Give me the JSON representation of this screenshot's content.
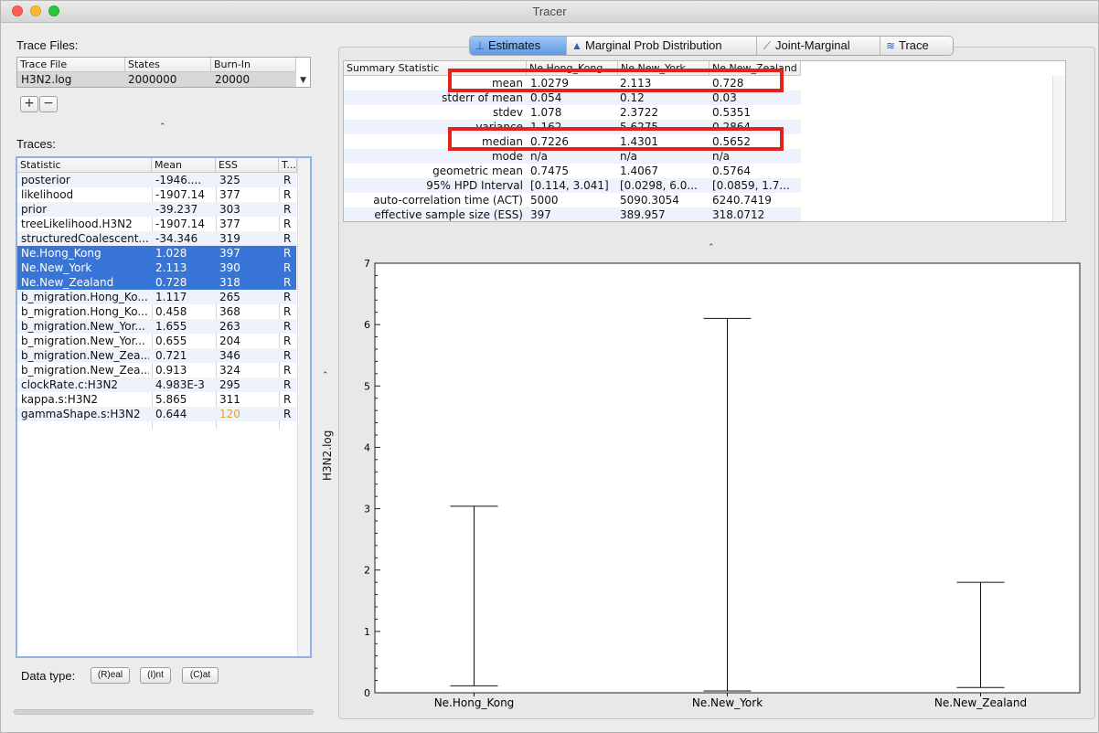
{
  "window": {
    "title": "Tracer"
  },
  "files": {
    "label": "Trace Files:",
    "headers": [
      "Trace File",
      "States",
      "Burn-In"
    ],
    "row": {
      "file": "H3N2.log",
      "states": "2000000",
      "burnin": "20000"
    },
    "add_label": "+",
    "remove_label": "−"
  },
  "traces": {
    "label": "Traces:",
    "headers": [
      "Statistic",
      "Mean",
      "ESS",
      "T..."
    ],
    "rows": [
      {
        "stat": "posterior",
        "mean": "-1946....",
        "ess": "325",
        "type": "R"
      },
      {
        "stat": "likelihood",
        "mean": "-1907.14",
        "ess": "377",
        "type": "R"
      },
      {
        "stat": "prior",
        "mean": "-39.237",
        "ess": "303",
        "type": "R"
      },
      {
        "stat": "treeLikelihood.H3N2",
        "mean": "-1907.14",
        "ess": "377",
        "type": "R"
      },
      {
        "stat": "structuredCoalescent....",
        "mean": "-34.346",
        "ess": "319",
        "type": "R"
      },
      {
        "stat": "Ne.Hong_Kong",
        "mean": "1.028",
        "ess": "397",
        "type": "R"
      },
      {
        "stat": "Ne.New_York",
        "mean": "2.113",
        "ess": "390",
        "type": "R"
      },
      {
        "stat": "Ne.New_Zealand",
        "mean": "0.728",
        "ess": "318",
        "type": "R"
      },
      {
        "stat": "b_migration.Hong_Ko...",
        "mean": "1.117",
        "ess": "265",
        "type": "R"
      },
      {
        "stat": "b_migration.Hong_Ko...",
        "mean": "0.458",
        "ess": "368",
        "type": "R"
      },
      {
        "stat": "b_migration.New_Yor...",
        "mean": "1.655",
        "ess": "263",
        "type": "R"
      },
      {
        "stat": "b_migration.New_Yor...",
        "mean": "0.655",
        "ess": "204",
        "type": "R"
      },
      {
        "stat": "b_migration.New_Zea...",
        "mean": "0.721",
        "ess": "346",
        "type": "R"
      },
      {
        "stat": "b_migration.New_Zea...",
        "mean": "0.913",
        "ess": "324",
        "type": "R"
      },
      {
        "stat": "clockRate.c:H3N2",
        "mean": "4.983E-3",
        "ess": "295",
        "type": "R"
      },
      {
        "stat": "kappa.s:H3N2",
        "mean": "5.865",
        "ess": "311",
        "type": "R"
      },
      {
        "stat": "gammaShape.s:H3N2",
        "mean": "0.644",
        "ess": "120",
        "type": "R"
      }
    ],
    "selected_indices": [
      5,
      6,
      7
    ],
    "low_ess_color": "#e8a23a"
  },
  "datatype": {
    "label": "Data type:",
    "real": "(R)eal",
    "int": "(I)nt",
    "cat": "(C)at"
  },
  "tabs": [
    {
      "label": "Estimates",
      "icon": "estimates-icon"
    },
    {
      "label": "Marginal Prob Distribution",
      "icon": "distribution-icon"
    },
    {
      "label": "Joint-Marginal",
      "icon": "joint-marginal-icon"
    },
    {
      "label": "Trace",
      "icon": "trace-icon"
    }
  ],
  "summary": {
    "headers": [
      "Summary Statistic",
      "Ne.Hong_Kong",
      "Ne.New_York",
      "Ne.New_Zealand"
    ],
    "rows": [
      {
        "name": "mean",
        "hk": "1.0279",
        "ny": "2.113",
        "nz": "0.728"
      },
      {
        "name": "stderr of mean",
        "hk": "0.054",
        "ny": "0.12",
        "nz": "0.03"
      },
      {
        "name": "stdev",
        "hk": "1.078",
        "ny": "2.3722",
        "nz": "0.5351"
      },
      {
        "name": "variance",
        "hk": "1.162",
        "ny": "5.6275",
        "nz": "0.2864"
      },
      {
        "name": "median",
        "hk": "0.7226",
        "ny": "1.4301",
        "nz": "0.5652"
      },
      {
        "name": "mode",
        "hk": "n/a",
        "ny": "n/a",
        "nz": "n/a"
      },
      {
        "name": "geometric mean",
        "hk": "0.7475",
        "ny": "1.4067",
        "nz": "0.5764"
      },
      {
        "name": "95% HPD Interval",
        "hk": "[0.114, 3.041]",
        "ny": "[0.0298, 6.0...",
        "nz": "[0.0859, 1.7..."
      },
      {
        "name": "auto-correlation time (ACT)",
        "hk": "5000",
        "ny": "5090.3054",
        "nz": "6240.7419"
      },
      {
        "name": "effective sample size (ESS)",
        "hk": "397",
        "ny": "389.957",
        "nz": "318.0712"
      }
    ],
    "highlight_color": "#e0231b"
  },
  "chart_data": {
    "type": "boxplot",
    "ylabel": "H3N2.log",
    "ylim": [
      0,
      7
    ],
    "yticks": [
      "0",
      "1",
      "2",
      "3",
      "4",
      "5",
      "6",
      "7"
    ],
    "categories": [
      "Ne.Hong_Kong",
      "Ne.New_York",
      "Ne.New_Zealand"
    ],
    "intervals": [
      {
        "low": 0.114,
        "high": 3.041
      },
      {
        "low": 0.0298,
        "high": 6.1
      },
      {
        "low": 0.0859,
        "high": 1.8
      }
    ]
  }
}
